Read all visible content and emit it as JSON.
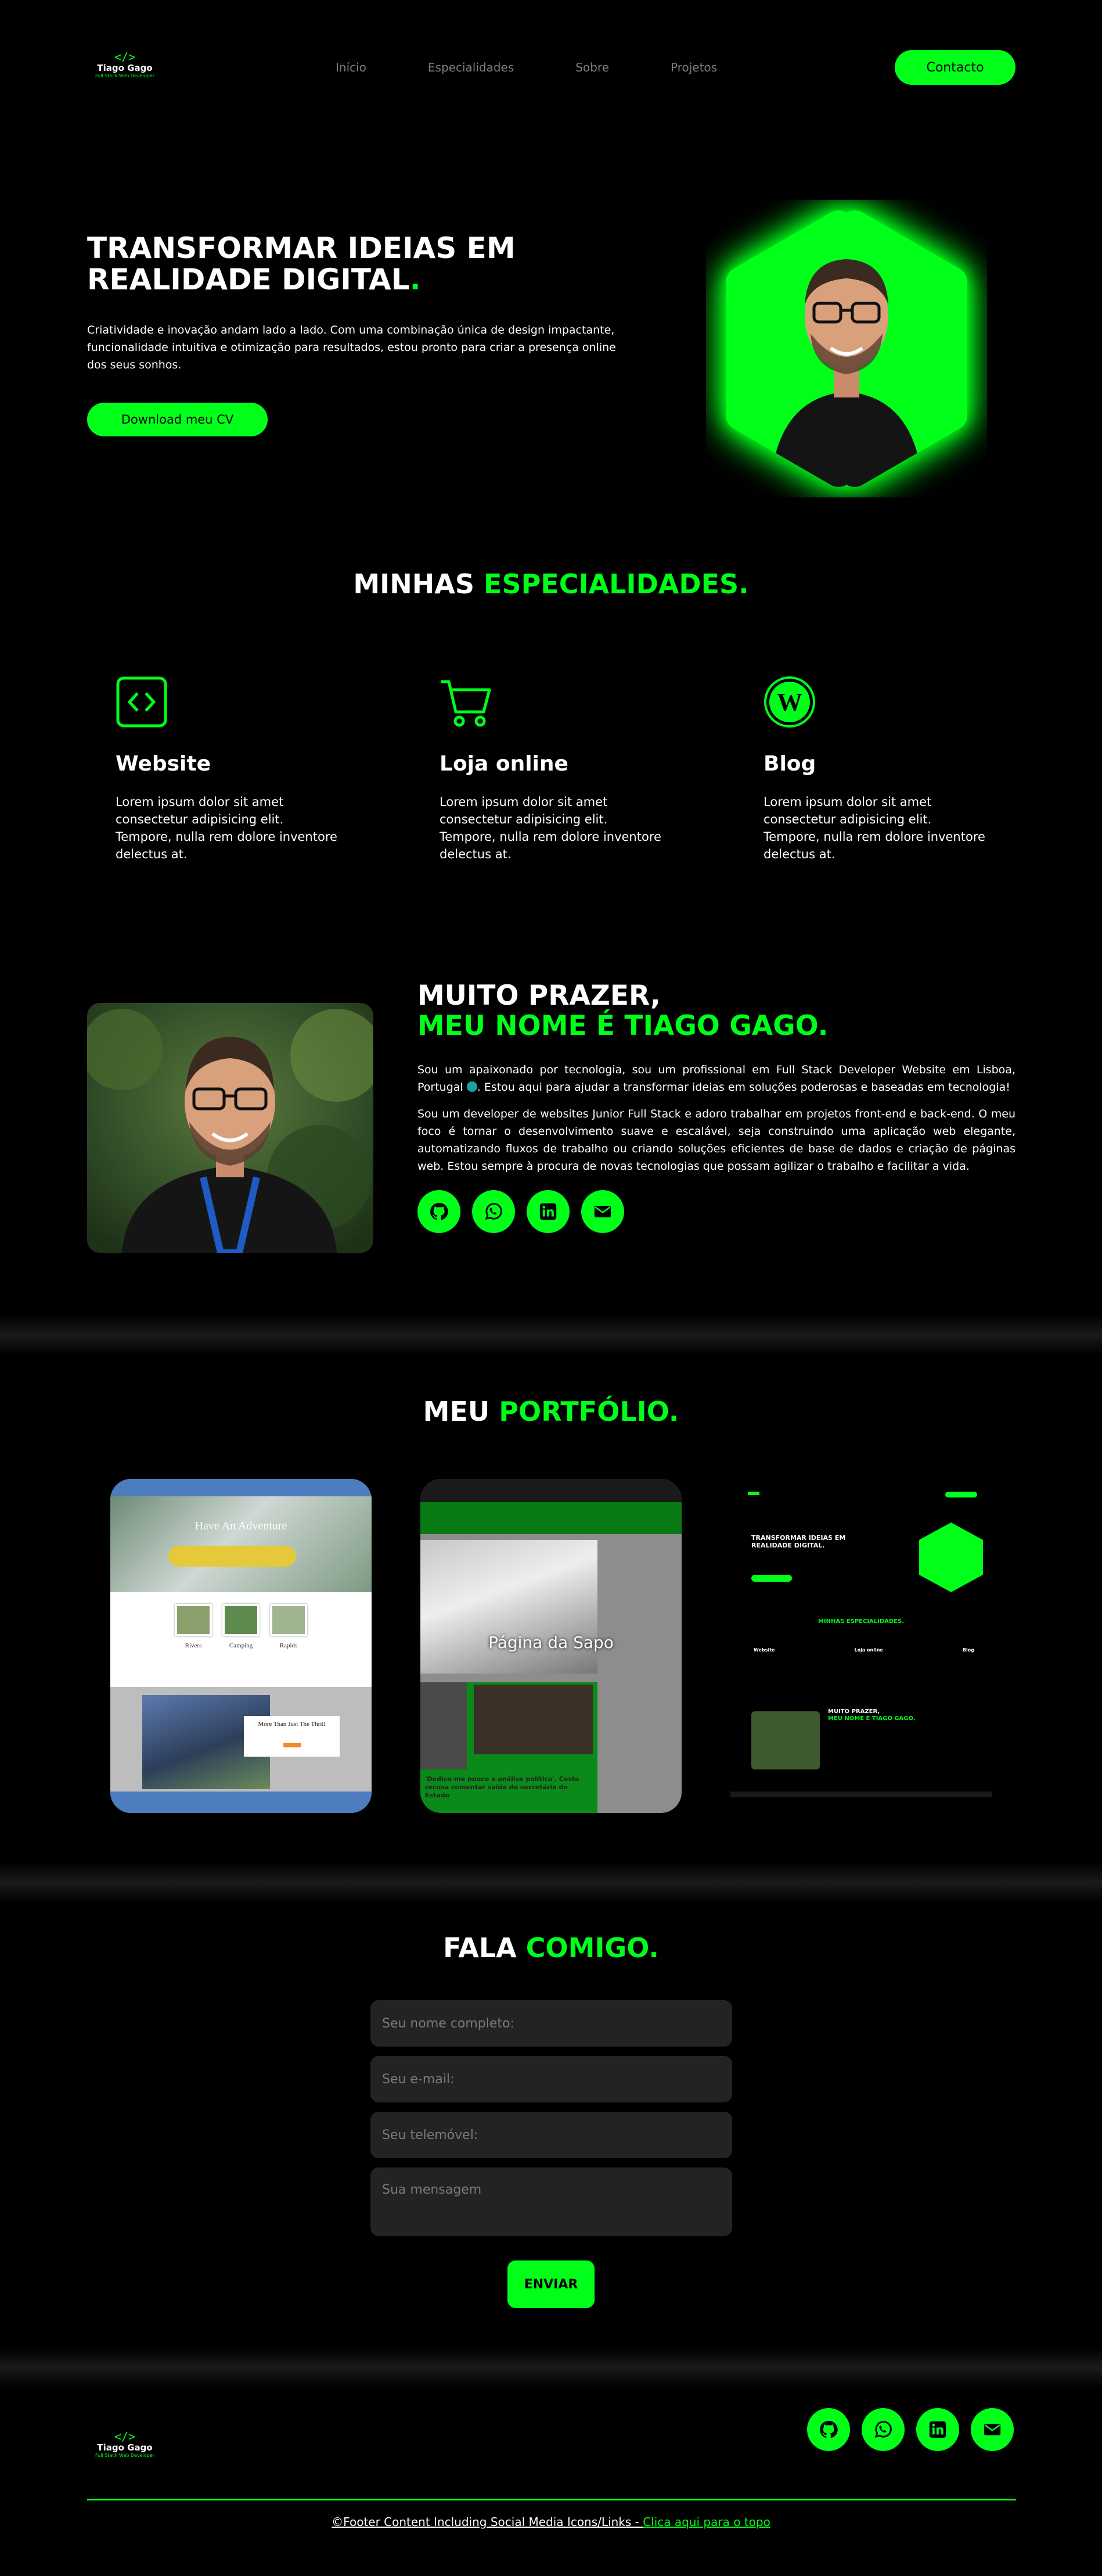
{
  "brand": {
    "name": "Tiago Gago",
    "tagline": "Full Stack Web Developer",
    "accent": "#00ff19",
    "background": "#000000"
  },
  "nav": {
    "items": [
      "Início",
      "Especialidades",
      "Sobre",
      "Projetos"
    ],
    "contact_label": "Contacto"
  },
  "hero": {
    "title_line1": "TRANSFORMAR IDEIAS EM",
    "title_line2": "REALIDADE DIGITAL",
    "title_dot": ".",
    "text": "Criatividade e inovação andam lado a lado. Com uma combinação única de design impactante, funcionalidade intuitiva e otimização para resultados, estou pronto para criar a presença online dos seus sonhos.",
    "cv_label": "Download meu CV"
  },
  "specialties": {
    "title_a": "MINHAS ",
    "title_b": "ESPECIALIDADES.",
    "items": [
      {
        "icon": "code-icon",
        "title": "Website",
        "text": "Lorem ipsum dolor sit amet consectetur adipisicing elit. Tempore, nulla rem dolore inventore delectus at."
      },
      {
        "icon": "cart-icon",
        "title": "Loja online",
        "text": "Lorem ipsum dolor sit amet consectetur adipisicing elit. Tempore, nulla rem dolore inventore delectus at."
      },
      {
        "icon": "wordpress-icon",
        "title": "Blog",
        "text": "Lorem ipsum dolor sit amet consectetur adipisicing elit. Tempore, nulla rem dolore inventore delectus at."
      }
    ]
  },
  "about": {
    "title_line1": "MUITO PRAZER,",
    "title_line2": "MEU NOME É TIAGO GAGO.",
    "p1_a": "Sou um apaixonado por tecnologia, sou um profissional em Full Stack Developer Website em Lisboa, Portugal ",
    "p1_b": ". Estou aqui para ajudar a transformar ideias em soluções poderosas e baseadas em tecnologia!",
    "p2": "Sou um developer de websites Junior Full Stack e adoro trabalhar em projetos front-end e back-end. O meu foco é tornar o desenvolvimento suave e escalável, seja construindo uma aplicação web elegante, automatizando fluxos de trabalho ou criando soluções eficientes de base de dados e criação de páginas web. Estou sempre à procura de novas tecnologias que possam agilizar o trabalho e facilitar a vida.",
    "social": [
      "github-icon",
      "whatsapp-icon",
      "linkedin-icon",
      "email-icon"
    ]
  },
  "portfolio": {
    "title_a": "MEU ",
    "title_b": "PORTFÓLIO.",
    "p1": {
      "hero": "Have An Adventure",
      "cards": [
        "Rivers",
        "Camping",
        "Rapids"
      ],
      "promo": "More Than Just The Thrill"
    },
    "p2": {
      "title": "Página da Sapo",
      "headline": "'Dedico-me pouco a análise política'. Cesta recusa comentar saída do secretário de Estado"
    },
    "p3": {
      "title": "TRANSFORMAR IDEIAS EM REALIDADE DIGITAL.",
      "spec": "MINHAS ESPECIALIDADES.",
      "items": [
        "Website",
        "Loja online",
        "Blog"
      ],
      "about": "MUITO PRAZER,",
      "about2": "MEU NOME É TIAGO GAGO."
    }
  },
  "contact": {
    "title_a": "FALA ",
    "title_b": "COMIGO.",
    "name_placeholder": "Seu nome completo:",
    "email_placeholder": "Seu e-mail:",
    "phone_placeholder": "Seu telemóvel:",
    "message_placeholder": "Sua mensagem",
    "send_label": "ENVIAR"
  },
  "footer": {
    "text": "©Footer Content Including Social Media Icons/Links - ",
    "link": "Clica aqui para o topo"
  }
}
